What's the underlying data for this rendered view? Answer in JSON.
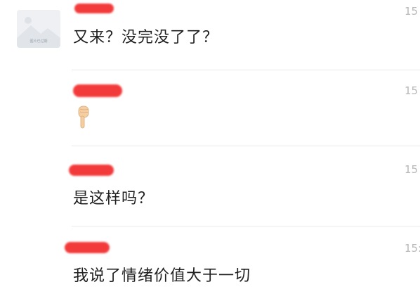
{
  "messages": [
    {
      "text": "又来？没完没了了？",
      "time": "15"
    },
    {
      "text": "",
      "emoji": "pointing-down-hand",
      "time": "15"
    },
    {
      "text": "是这样吗？",
      "time": "15"
    },
    {
      "text": "我说了情绪价值大于一切",
      "time": "15:"
    }
  ],
  "avatar": {
    "icon": "image-placeholder-icon",
    "caption": "图片已过期"
  },
  "colors": {
    "redaction": "#f33a3a",
    "text": "#1f1f1f",
    "time": "#b8b8b8",
    "divider": "#e9e9e9"
  }
}
